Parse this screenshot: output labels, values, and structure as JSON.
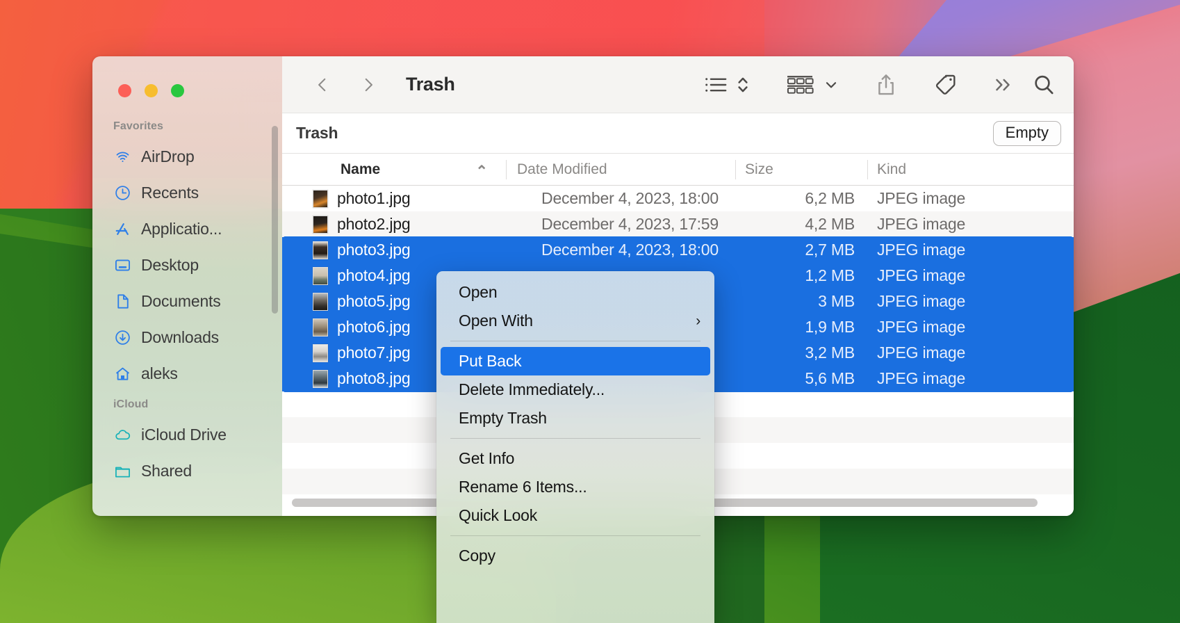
{
  "window": {
    "title": "Trash",
    "traffic_lights": [
      "close",
      "minimize",
      "maximize"
    ]
  },
  "toolbar": {
    "back_icon": "chevron-left-icon",
    "forward_icon": "chevron-right-icon",
    "view_list_icon": "list-view-icon",
    "sort_icon": "sort-updown-icon",
    "group_icon": "group-by-icon",
    "group_chevron_icon": "chevron-down-icon",
    "share_icon": "share-icon",
    "tag_icon": "tag-icon",
    "more_icon": "chevrons-right-icon",
    "search_icon": "search-icon"
  },
  "path_bar": {
    "label": "Trash",
    "empty_label": "Empty"
  },
  "columns": [
    {
      "key": "name",
      "label": "Name",
      "sort": "ascending",
      "sort_glyph": "⌃"
    },
    {
      "key": "date",
      "label": "Date Modified"
    },
    {
      "key": "size",
      "label": "Size"
    },
    {
      "key": "kind",
      "label": "Kind"
    }
  ],
  "files": [
    {
      "name": "photo1.jpg",
      "date": "December 4, 2023, 18:00",
      "size": "6,2 MB",
      "kind": "JPEG image",
      "selected": false,
      "thumb": "linear-gradient(160deg,#2b231c 0%,#4a3524 40%,#d8862c 70%,#201a14 100%)"
    },
    {
      "name": "photo2.jpg",
      "date": "December 4, 2023, 17:59",
      "size": "4,2 MB",
      "kind": "JPEG image",
      "selected": false,
      "thumb": "linear-gradient(170deg,#1c1916 0%,#2e2620 45%,#e0801f 78%,#171310 100%)"
    },
    {
      "name": "photo3.jpg",
      "date": "December 4, 2023, 18:00",
      "size": "2,7 MB",
      "kind": "JPEG image",
      "selected": true,
      "thumb": "linear-gradient(180deg,#e7e2da 0%,#3a2f26 30%,#241c16 70%,#cfc7bb 100%)"
    },
    {
      "name": "photo4.jpg",
      "date": "",
      "size": "1,2 MB",
      "kind": "JPEG image",
      "selected": true,
      "thumb": "linear-gradient(180deg,#d9d3c7 0%,#c8bfae 48%,#6d7a6a 72%,#424b40 100%)"
    },
    {
      "name": "photo5.jpg",
      "date": "",
      "size": "3 MB",
      "kind": "JPEG image",
      "selected": true,
      "thumb": "linear-gradient(180deg,#b9bdc0 0%,#6f6a63 40%,#34302b 75%,#1b1916 100%)"
    },
    {
      "name": "photo6.jpg",
      "date": "",
      "size": "1,9 MB",
      "kind": "JPEG image",
      "selected": true,
      "thumb": "linear-gradient(180deg,#cfc6b8 0%,#9b8d79 45%,#6a5d4c 75%,#b3a996 100%)"
    },
    {
      "name": "photo7.jpg",
      "date": "",
      "size": "3,2 MB",
      "kind": "JPEG image",
      "selected": true,
      "thumb": "linear-gradient(180deg,#eceae6 0%,#d6d2cc 40%,#8e8a84 70%,#e4e1dc 100%)"
    },
    {
      "name": "photo8.jpg",
      "date": "",
      "size": "5,6 MB",
      "kind": "JPEG image",
      "selected": true,
      "thumb": "linear-gradient(180deg,#9aa7ae 0%,#5d6b72 40%,#2f3a40 75%,#c8cfd3 100%)"
    }
  ],
  "sidebar": {
    "sections": [
      {
        "title": "Favorites",
        "items": [
          {
            "label": "AirDrop",
            "icon": "airdrop-icon"
          },
          {
            "label": "Recents",
            "icon": "clock-icon"
          },
          {
            "label": "Applicatio...",
            "icon": "applications-icon"
          },
          {
            "label": "Desktop",
            "icon": "desktop-icon"
          },
          {
            "label": "Documents",
            "icon": "document-icon"
          },
          {
            "label": "Downloads",
            "icon": "download-icon"
          },
          {
            "label": "aleks",
            "icon": "home-icon"
          }
        ]
      },
      {
        "title": "iCloud",
        "items": [
          {
            "label": "iCloud Drive",
            "icon": "cloud-icon"
          },
          {
            "label": "Shared",
            "icon": "shared-folder-icon"
          }
        ]
      }
    ]
  },
  "context_menu": {
    "groups": [
      [
        {
          "label": "Open",
          "highlighted": false,
          "submenu": false
        },
        {
          "label": "Open With",
          "highlighted": false,
          "submenu": true,
          "arrow": "›"
        }
      ],
      [
        {
          "label": "Put Back",
          "highlighted": true,
          "submenu": false
        },
        {
          "label": "Delete Immediately...",
          "highlighted": false,
          "submenu": false
        },
        {
          "label": "Empty Trash",
          "highlighted": false,
          "submenu": false
        }
      ],
      [
        {
          "label": "Get Info",
          "highlighted": false,
          "submenu": false
        },
        {
          "label": "Rename 6 Items...",
          "highlighted": false,
          "submenu": false
        },
        {
          "label": "Quick Look",
          "highlighted": false,
          "submenu": false
        }
      ],
      [
        {
          "label": "Copy",
          "highlighted": false,
          "submenu": false
        }
      ]
    ]
  },
  "colors": {
    "selection_blue": "#1a6fe0",
    "menu_highlight_blue": "#1a73e8",
    "accent_icon_blue": "#2f7fe8",
    "icloud_teal": "#18b2b8"
  }
}
